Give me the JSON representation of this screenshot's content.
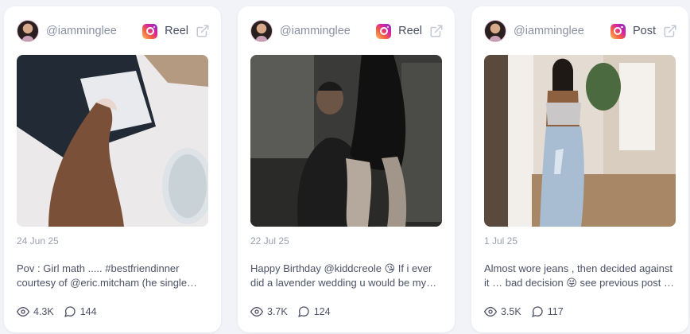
{
  "posts": [
    {
      "handle": "@iamminglee",
      "type": "Reel",
      "date": "24 Jun 25",
      "caption": "Pov : Girl math ..... #bestfriendinner courtesy of @eric.mitcham (he single…",
      "views": "4.3K",
      "comments": "144",
      "platform_icon": "instagram-icon"
    },
    {
      "handle": "@iamminglee",
      "type": "Reel",
      "date": "22 Jul 25",
      "caption": "Happy Birthday @kiddcreole 😘 If i ever did a lavender wedding u would be my…",
      "views": "3.7K",
      "comments": "124",
      "platform_icon": "instagram-icon"
    },
    {
      "handle": "@iamminglee",
      "type": "Post",
      "date": "1 Jul 25",
      "caption": "Almost wore jeans , then decided against it … bad decision 😝 see previous post …",
      "views": "3.5K",
      "comments": "117",
      "platform_icon": "instagram-icon"
    }
  ],
  "colors": {
    "background": "#f1f3f8",
    "card": "#ffffff",
    "muted_text": "#9aa0b2",
    "body_text": "#4d5266"
  }
}
